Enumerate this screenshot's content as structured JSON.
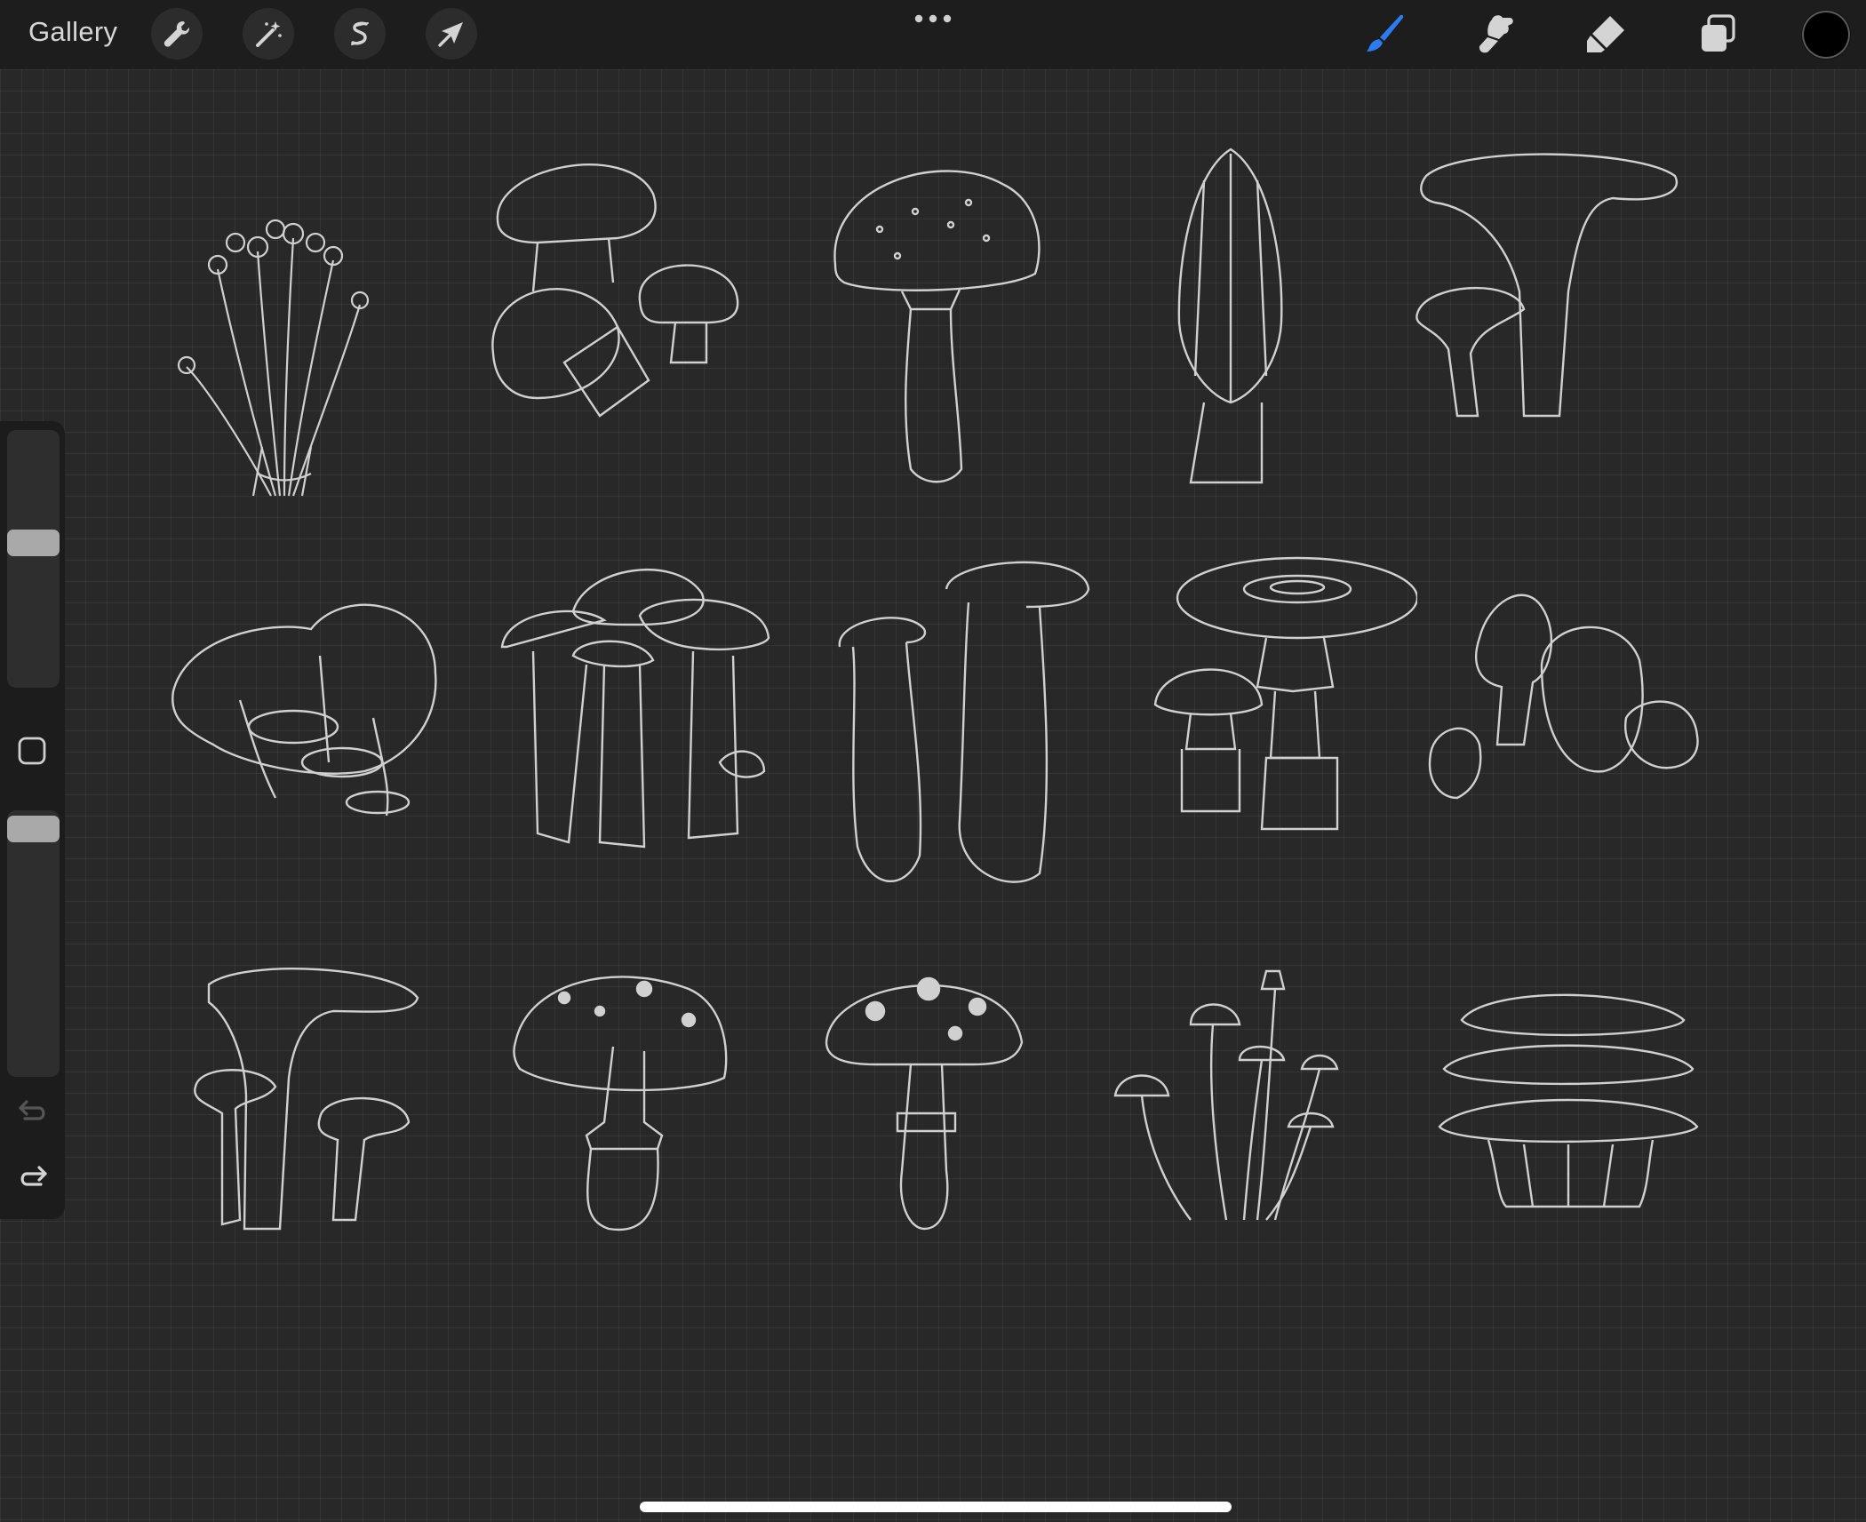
{
  "topbar": {
    "gallery_label": "Gallery",
    "left_tools": [
      "wrench-icon",
      "magic-wand-icon",
      "selection-icon",
      "transform-arrow-icon"
    ],
    "right_tools": [
      "brush-icon",
      "smudge-icon",
      "eraser-icon",
      "layers-icon"
    ],
    "active_tool": "brush-icon",
    "active_color": "#000000",
    "accent_color": "#2a7cf0"
  },
  "sidebar": {
    "brush_size_level": 0.45,
    "opacity_level": 0.2
  },
  "canvas": {
    "artwork_rows": [
      [
        "enoki-mushroom-cluster",
        "button-mushrooms",
        "speckled-cap-mushroom",
        "morel-mushroom",
        "chanterelle-mushrooms"
      ],
      [
        "oyster-mushroom-cluster",
        "honey-mushroom-cluster",
        "king-oyster-mushrooms",
        "parasol-mushrooms",
        "puffball-cluster"
      ],
      [
        "trumpet-mushrooms",
        "spotted-mushroom",
        "toadstool-mushroom",
        "thin-stem-mushroom-cluster",
        "layered-oyster-mushrooms"
      ]
    ]
  }
}
